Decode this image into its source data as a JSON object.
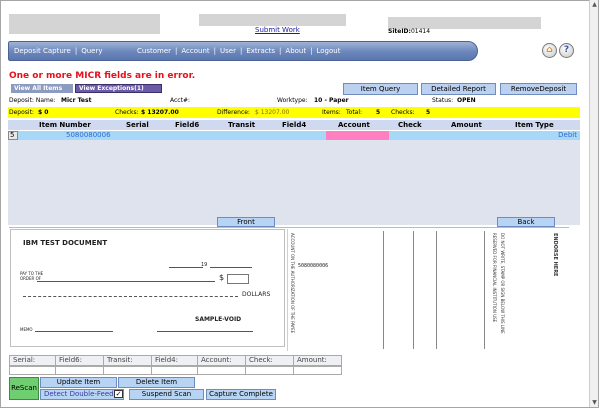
{
  "header": {
    "submit_work": "Submit Work",
    "site_id_label": "SiteID:",
    "site_id_value": "01414"
  },
  "nav": {
    "left_items": [
      "Deposit Capture",
      "Query"
    ],
    "right_items": [
      "Customer",
      "Account",
      "User",
      "Extracts",
      "About",
      "Logout"
    ]
  },
  "error_message": "One or more MICR fields are in error.",
  "view_buttons": {
    "all": "View All Items",
    "exceptions": "View Exceptions(1)"
  },
  "actions": {
    "item_query": "Item Query",
    "detailed_report": "Detailed Report",
    "remove_deposit": "RemoveDeposit"
  },
  "deposit": {
    "name_label": "Deposit: Name:",
    "name_value": "Micr Test",
    "acct_label": "Acct#:",
    "worktype_label": "Worktype:",
    "worktype_value": "10 - Paper",
    "status_label": "Status:",
    "status_value": "OPEN"
  },
  "totals": {
    "deposit_label": "Deposit:",
    "deposit_value": "$ 0",
    "checks_label": "Checks:",
    "checks_value": "$ 13207.00",
    "difference_label": "Difference:",
    "difference_value": "$ 13207.00",
    "items_label": "Items:",
    "total_label": "Total:",
    "total_value": "5",
    "checks_count_label": "Checks:",
    "checks_count_value": "5"
  },
  "grid": {
    "columns": [
      "Item Number",
      "Serial",
      "Field6",
      "Transit",
      "Field4",
      "Account",
      "Check",
      "Amount",
      "Item Type"
    ],
    "row": {
      "num": "5",
      "item_number": "5080080006",
      "item_type": "Debit"
    }
  },
  "image": {
    "front_tab": "Front",
    "back_tab": "Back",
    "front": {
      "title": "IBM TEST DOCUMENT",
      "pay_to": "PAY TO THE",
      "order_of": "ORDER OF",
      "dollar_sign": "$",
      "year": "19",
      "dollars": "DOLLARS",
      "sample_void": "SAMPLE-VOID",
      "memo": "MEMO"
    },
    "back": {
      "number": "5080080006",
      "endorse": "ENDORSE HERE",
      "do_not_write": "DO NOT WRITE, STAMP OR SIGN BELOW THIS LINE",
      "reserved": "RESERVED FOR FINANCIAL INSTITUTION USE",
      "account_auth": "ACCOUNT ON THE AUTHORIZATION OF THE PAYEE"
    }
  },
  "fields": [
    "Serial:",
    "Field6:",
    "Transit:",
    "Field4:",
    "Account:",
    "Check:",
    "Amount:"
  ],
  "bottom": {
    "rescan": "ReScan",
    "update_item": "Update Item",
    "delete_item": "Delete Item",
    "detect_double": "Detect Double-Feed",
    "detect_checked": "✓",
    "suspend_scan": "Suspend Scan",
    "capture_complete": "Capture Complete"
  },
  "colors": {
    "nav": "#6a86bb",
    "error": "#e8101c",
    "totals_bg": "#ffff00",
    "row_bg": "#a8d8f8",
    "account_error": "#ff80c0",
    "rescan": "#6fce6f"
  }
}
